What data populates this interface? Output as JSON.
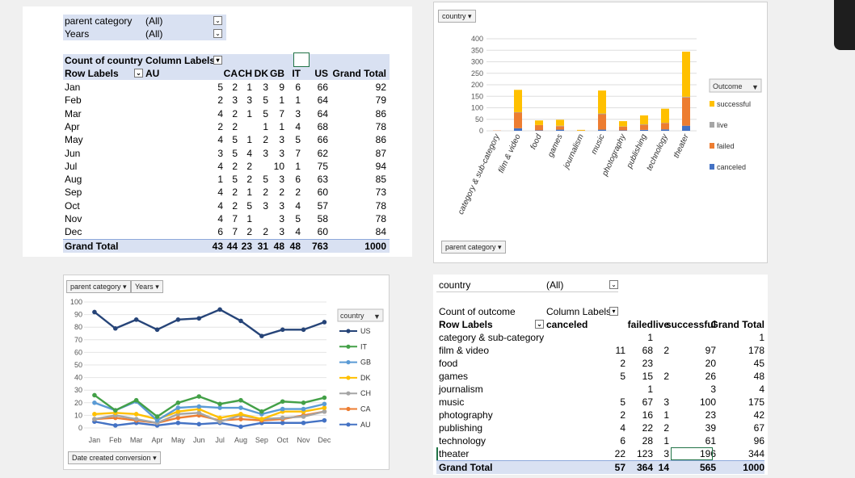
{
  "pivot_country": {
    "filters": [
      {
        "label": "parent category",
        "value": "(All)"
      },
      {
        "label": "Years",
        "value": "(All)"
      }
    ],
    "header1": {
      "measure": "Count of country",
      "col_labels": "Column Labels"
    },
    "header2": {
      "row_labels": "Row Labels",
      "first_col": "AU"
    },
    "columns": [
      "CA",
      "CH",
      "DK",
      "GB",
      "IT",
      "US",
      "Grand Total"
    ],
    "rows": [
      {
        "label": "Jan",
        "values": [
          "5",
          "2",
          "1",
          "3",
          "9",
          "6",
          "66",
          "92"
        ]
      },
      {
        "label": "Feb",
        "values": [
          "2",
          "3",
          "3",
          "5",
          "1",
          "1",
          "64",
          "79"
        ]
      },
      {
        "label": "Mar",
        "values": [
          "4",
          "2",
          "1",
          "5",
          "7",
          "3",
          "64",
          "86"
        ]
      },
      {
        "label": "Apr",
        "values": [
          "2",
          "2",
          "",
          "1",
          "1",
          "4",
          "68",
          "78"
        ]
      },
      {
        "label": "May",
        "values": [
          "4",
          "5",
          "1",
          "2",
          "3",
          "5",
          "66",
          "86"
        ]
      },
      {
        "label": "Jun",
        "values": [
          "3",
          "5",
          "4",
          "3",
          "3",
          "7",
          "62",
          "87"
        ]
      },
      {
        "label": "Jul",
        "values": [
          "4",
          "2",
          "2",
          "",
          "10",
          "1",
          "75",
          "94"
        ]
      },
      {
        "label": "Aug",
        "values": [
          "1",
          "5",
          "2",
          "5",
          "3",
          "6",
          "63",
          "85"
        ]
      },
      {
        "label": "Sep",
        "values": [
          "4",
          "2",
          "1",
          "2",
          "2",
          "2",
          "60",
          "73"
        ]
      },
      {
        "label": "Oct",
        "values": [
          "4",
          "2",
          "5",
          "3",
          "3",
          "4",
          "57",
          "78"
        ]
      },
      {
        "label": "Nov",
        "values": [
          "4",
          "7",
          "1",
          "",
          "3",
          "5",
          "58",
          "78"
        ]
      },
      {
        "label": "Dec",
        "values": [
          "6",
          "7",
          "2",
          "2",
          "3",
          "4",
          "60",
          "84"
        ]
      }
    ],
    "total": {
      "label": "Grand Total",
      "values": [
        "43",
        "44",
        "23",
        "31",
        "48",
        "48",
        "763",
        "1000"
      ]
    }
  },
  "pivot_outcome": {
    "filter": {
      "label": "country",
      "value": "(All)"
    },
    "header1": {
      "measure": "Count of outcome",
      "col_labels": "Column Labels"
    },
    "header2": {
      "row_labels": "Row Labels",
      "first_col": "canceled"
    },
    "columns": [
      "failed",
      "live",
      "successful",
      "Grand Total"
    ],
    "rows": [
      {
        "label": "category & sub-category",
        "values": [
          "",
          "1",
          "",
          "",
          "1"
        ]
      },
      {
        "label": "film & video",
        "values": [
          "11",
          "68",
          "2",
          "97",
          "178"
        ]
      },
      {
        "label": "food",
        "values": [
          "2",
          "23",
          "",
          "20",
          "45"
        ]
      },
      {
        "label": "games",
        "values": [
          "5",
          "15",
          "2",
          "26",
          "48"
        ]
      },
      {
        "label": "journalism",
        "values": [
          "",
          "1",
          "",
          "3",
          "4"
        ]
      },
      {
        "label": "music",
        "values": [
          "5",
          "67",
          "3",
          "100",
          "175"
        ]
      },
      {
        "label": "photography",
        "values": [
          "2",
          "16",
          "1",
          "23",
          "42"
        ]
      },
      {
        "label": "publishing",
        "values": [
          "4",
          "22",
          "2",
          "39",
          "67"
        ]
      },
      {
        "label": "technology",
        "values": [
          "6",
          "28",
          "1",
          "61",
          "96"
        ]
      },
      {
        "label": "theater",
        "values": [
          "22",
          "123",
          "3",
          "196",
          "344"
        ]
      }
    ],
    "total": {
      "label": "Grand Total",
      "values": [
        "57",
        "364",
        "14",
        "565",
        "1000"
      ]
    }
  },
  "chart_data": [
    {
      "type": "bar",
      "stacked": true,
      "filter_chip": "country",
      "axis_chip": "parent category",
      "categories": [
        "category & sub-category",
        "film & video",
        "food",
        "games",
        "journalism",
        "music",
        "photography",
        "publishing",
        "technology",
        "theater"
      ],
      "series": [
        {
          "name": "canceled",
          "color": "#4472c4",
          "values": [
            0,
            11,
            2,
            5,
            0,
            5,
            2,
            4,
            6,
            22
          ]
        },
        {
          "name": "failed",
          "color": "#ed7d31",
          "values": [
            1,
            68,
            23,
            15,
            1,
            67,
            16,
            22,
            28,
            123
          ]
        },
        {
          "name": "live",
          "color": "#a5a5a5",
          "values": [
            0,
            2,
            0,
            2,
            0,
            3,
            1,
            2,
            1,
            3
          ]
        },
        {
          "name": "successful",
          "color": "#ffc000",
          "values": [
            0,
            97,
            20,
            26,
            3,
            100,
            23,
            39,
            61,
            196
          ]
        }
      ],
      "legend_title": "Outcome",
      "legend_order": [
        "successful",
        "live",
        "failed",
        "canceled"
      ],
      "ylim": [
        0,
        400
      ],
      "yticks": [
        0,
        50,
        100,
        150,
        200,
        250,
        300,
        350,
        400
      ],
      "legend": "right",
      "grid": true
    },
    {
      "type": "line",
      "filter_chips": [
        "parent category",
        "Years"
      ],
      "axis_chip": "Date created conversion",
      "categories": [
        "Jan",
        "Feb",
        "Mar",
        "Apr",
        "May",
        "Jun",
        "Jul",
        "Aug",
        "Sep",
        "Oct",
        "Nov",
        "Dec"
      ],
      "series": [
        {
          "name": "US",
          "color": "#264478",
          "values": [
            92,
            79,
            86,
            78,
            86,
            87,
            94,
            85,
            73,
            78,
            78,
            84
          ]
        },
        {
          "name": "IT",
          "color": "#43a047",
          "values": [
            26,
            14,
            22,
            9,
            20,
            25,
            19,
            22,
            13,
            21,
            20,
            24
          ]
        },
        {
          "name": "GB",
          "color": "#5b9bd5",
          "values": [
            20,
            14,
            21,
            6,
            16,
            17,
            16,
            16,
            11,
            15,
            15,
            19
          ]
        },
        {
          "name": "DK",
          "color": "#ffc000",
          "values": [
            11,
            12,
            11,
            7,
            13,
            15,
            8,
            11,
            7,
            13,
            13,
            16
          ]
        },
        {
          "name": "CH",
          "color": "#a5a5a5",
          "values": [
            7,
            10,
            7,
            4,
            11,
            12,
            5,
            10,
            7,
            8,
            9,
            13
          ]
        },
        {
          "name": "CA",
          "color": "#ed7d31",
          "values": [
            7,
            8,
            6,
            4,
            8,
            10,
            6,
            7,
            6,
            7,
            10,
            13
          ]
        },
        {
          "name": "AU",
          "color": "#4472c4",
          "values": [
            5,
            2,
            4,
            2,
            4,
            3,
            4,
            1,
            4,
            4,
            4,
            6
          ]
        }
      ],
      "legend_title": "country",
      "ylim": [
        0,
        100
      ],
      "yticks": [
        0,
        10,
        20,
        30,
        40,
        50,
        60,
        70,
        80,
        90,
        100
      ],
      "legend": "right",
      "grid": true
    }
  ]
}
